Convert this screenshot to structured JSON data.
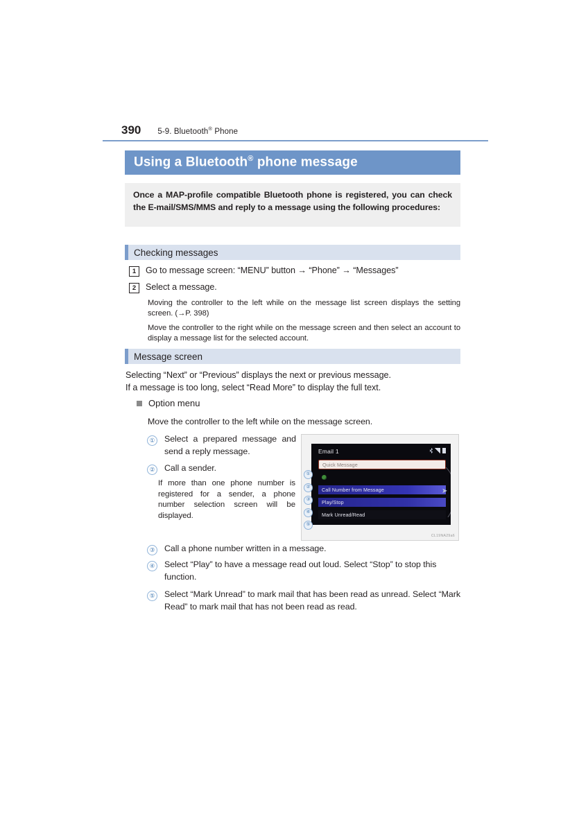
{
  "header": {
    "page_number": "390",
    "section_label": "5-9. Bluetooth",
    "section_label_sup": "®",
    "section_label_tail": " Phone",
    "rule_color": "#7c9dcb"
  },
  "banner": {
    "title_before": "Using a Bluetooth",
    "title_sup": "®",
    "title_after": " phone message",
    "bg_color": "#6e95c8",
    "text_color": "#ffffff"
  },
  "intro": {
    "text": "Once a MAP-profile compatible Bluetooth phone is registered, you can check the E-mail/SMS/MMS and reply to a message using the following procedures:",
    "bg_color": "#efefef"
  },
  "sections": {
    "checking": {
      "title": "Checking messages",
      "bg_color": "#d9e1ee",
      "accent_color": "#7c9dcb"
    },
    "message": {
      "title": "Message screen",
      "bg_color": "#d9e1ee",
      "accent_color": "#7c9dcb"
    }
  },
  "steps": [
    {
      "num": "1",
      "text": "Go to message screen: “MENU” button → “Phone” → “Messages”"
    },
    {
      "num": "2",
      "text": "Select a message."
    }
  ],
  "notes": [
    "Moving the controller to the left while on the message list screen displays the setting screen. (→P. 398)",
    "Move the controller to the right while on the message screen and then select an account to display a message list for the selected account."
  ],
  "message_screen": {
    "line1": "Selecting “Next” or “Previous” displays the next or previous message.",
    "line2": "If a message is too long, select “Read More” to display the full text.",
    "subhead": "Option menu",
    "subnote": "Move the controller to the left while on the message screen."
  },
  "callouts": [
    {
      "num": "①",
      "text": "Select a prepared message and send a reply message."
    },
    {
      "num": "②",
      "text": "Call a sender.",
      "sub": "If more than one phone number is registered for a sender, a phone number selection screen will be displayed."
    },
    {
      "num": "③",
      "text": "Call a phone number written in a message."
    },
    {
      "num": "④",
      "text": "Select “Play” to have a message read out loud. Select “Stop” to stop this function."
    },
    {
      "num": "⑤",
      "text": "Select “Mark Unread” to mark mail that has been read as unread. Select “Mark Read” to mark mail that has not been read as read."
    }
  ],
  "figure": {
    "screen_title": "Email 1",
    "status_icons": [
      "bluetooth-icon",
      "signal-icon",
      "battery-icon"
    ],
    "rows": [
      {
        "label": "Quick Message",
        "marker": "①"
      },
      {
        "label": "",
        "marker": "②",
        "icon": "green-phone-icon"
      },
      {
        "label": "Call Number from Message",
        "marker": "③"
      },
      {
        "label": "Play/Stop",
        "marker": "④"
      },
      {
        "label": "Mark Unread/Read",
        "marker": "⑤"
      }
    ],
    "code": "CL19NA29a6"
  }
}
